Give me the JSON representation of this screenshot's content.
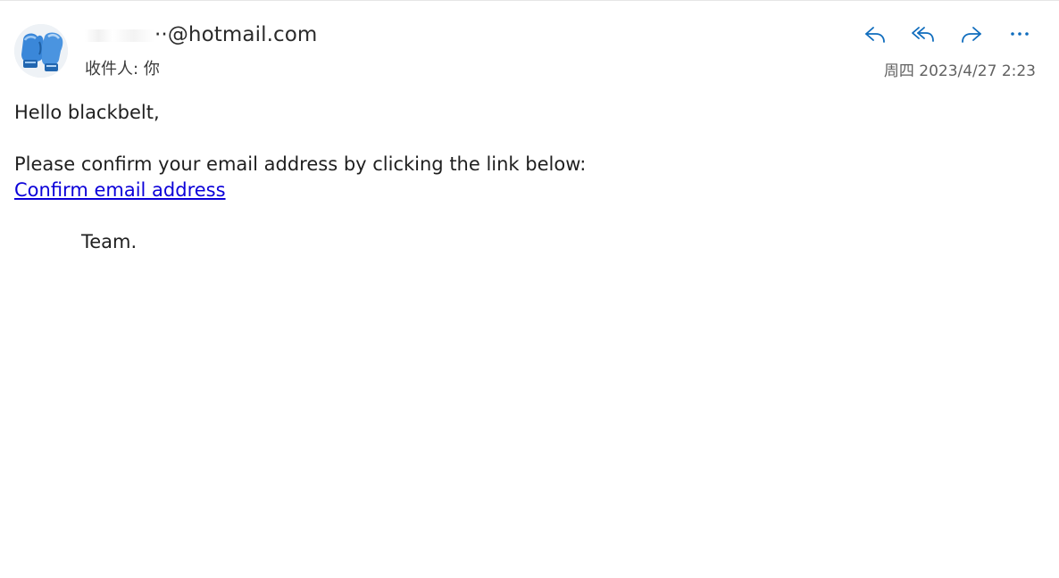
{
  "email": {
    "sender_address": "@hotmail.com",
    "sender_prefix_glyph": "··",
    "recipient_label": "收件人:",
    "recipient_value": "你",
    "date": "周四 2023/4/27 2:23",
    "greeting": "Hello blackbelt,",
    "body_text": "Please confirm your email address by clicking the link below:",
    "link_text": "Confirm email address",
    "signoff": "Team."
  },
  "actions": [
    {
      "icon": "reply-icon"
    },
    {
      "icon": "reply-all-icon"
    },
    {
      "icon": "forward-icon"
    },
    {
      "icon": "more-icon"
    }
  ],
  "colors": {
    "accent": "#0f6cbd",
    "link": "#0b00d9",
    "muted_text": "#616161"
  }
}
